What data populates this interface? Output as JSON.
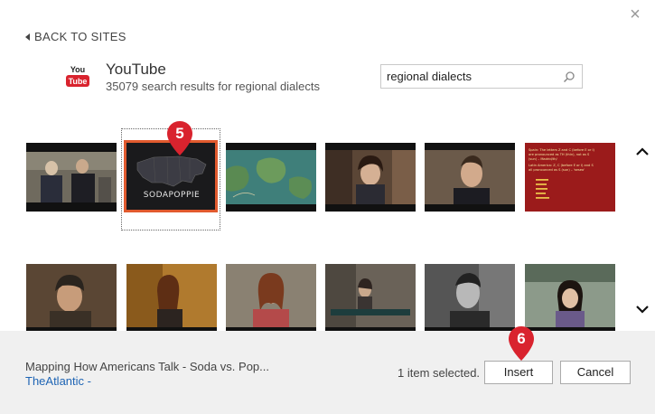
{
  "dialog": {
    "close_glyph": "×",
    "back_label": "BACK TO SITES"
  },
  "site": {
    "logo_text_top": "You",
    "logo_text_bottom": "Tube",
    "name": "YouTube",
    "result_summary": "35079 search results for regional dialects"
  },
  "search": {
    "value": "regional dialects",
    "icon": "search-icon"
  },
  "thumbnails_row1": [
    {
      "id": "two-men-interview",
      "selected": false
    },
    {
      "id": "sodapoppie-map",
      "selected": true,
      "logo_text": "SODAPOPPIE"
    },
    {
      "id": "map-satellite",
      "selected": false
    },
    {
      "id": "woman-laughing",
      "selected": false
    },
    {
      "id": "man-talking",
      "selected": false
    },
    {
      "id": "spain-slide",
      "selected": false,
      "slide_lines": [
        "Spain: The letters Z and C (before E or I)",
        "are pronounced as TH (thin), not as S",
        "(sun) – Madrid/th/",
        "Latin America: Z, C (before E or I) and S",
        "all pronounced as S (sun) – 'seseo'"
      ]
    }
  ],
  "thumbnails_row2": [
    {
      "id": "man-beanie"
    },
    {
      "id": "woman-phone"
    },
    {
      "id": "woman-smiling"
    },
    {
      "id": "woman-caption"
    },
    {
      "id": "man-bw"
    },
    {
      "id": "woman-glasses"
    }
  ],
  "callouts": {
    "step5": "5",
    "step6": "6"
  },
  "scroll": {
    "up_glyph": "⌃",
    "down_glyph": "⌄"
  },
  "footer": {
    "video_title": "Mapping How Americans Talk - Soda vs. Pop...",
    "video_source": "TheAtlantic -",
    "selected_count": "1 item selected.",
    "insert_label": "Insert",
    "cancel_label": "Cancel"
  },
  "colors": {
    "accent_orange": "#e15a2e",
    "callout_red": "#d9232e",
    "link_blue": "#1e64b4",
    "footer_bg": "#f0f0f0"
  }
}
